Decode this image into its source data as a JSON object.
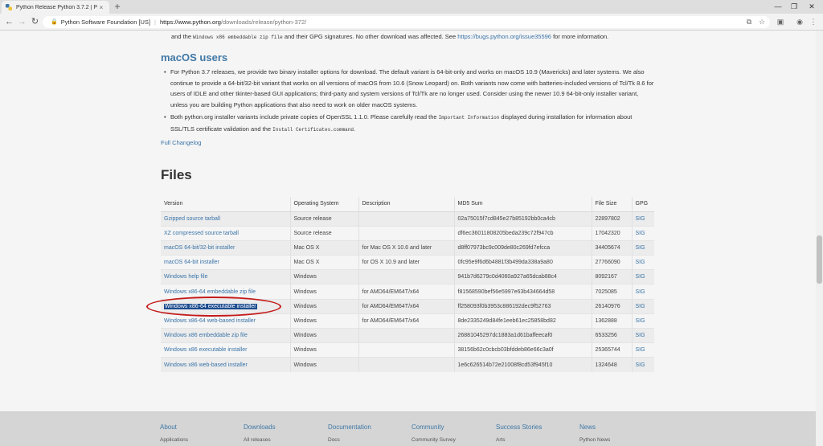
{
  "browser": {
    "tab_title": "Python Release Python 3.7.2 | Py",
    "tab_close": "×",
    "new_tab": "+",
    "url_site_label": "Python Software Foundation [US]",
    "url_host": "https://www.python.org",
    "url_path": "/downloads/release/python-372/",
    "win_min": "—",
    "win_max": "❐",
    "win_close": "✕"
  },
  "top_line": {
    "prefix": "and the ",
    "mono": "Windows x86 embeddable zip file",
    "middle": " and their GPG signatures. No other download was affected. See ",
    "link": "https://bugs.python.org/issue35596",
    "suffix": " for more information."
  },
  "macos": {
    "heading": "macOS users",
    "bullet1": "For Python 3.7 releases, we provide two binary installer options for download. The default variant is 64-bit-only and works on macOS 10.9 (Mavericks) and later systems. We also continue to provide a 64-bit/32-bit variant that works on all versions of macOS from 10.6 (Snow Leopard) on. Both variants now come with batteries-included versions of Tcl/Tk 8.6 for users of IDLE and other tkinter-based GUI applications; third-party and system versions of Tcl/Tk are no longer used. Consider using the newer 10.9 64-bit-only installer variant, unless you are building Python applications that also need to work on older macOS systems.",
    "bullet2_a": "Both python.org installer variants include private copies of OpenSSL 1.1.0. Please carefully read the ",
    "bullet2_mono1": "Important Information",
    "bullet2_b": " displayed during installation for information about SSL/TLS certificate validation and the ",
    "bullet2_mono2": "Install Certificates.command",
    "bullet2_c": "."
  },
  "changelog_link": "Full Changelog",
  "files": {
    "heading": "Files",
    "columns": [
      "Version",
      "Operating System",
      "Description",
      "MD5 Sum",
      "File Size",
      "GPG"
    ],
    "rows": [
      {
        "version": "Gzipped source tarball",
        "os": "Source release",
        "desc": "",
        "md5": "02a75015f7cd845e27b85192bb0ca4cb",
        "size": "22897802",
        "gpg": "SIG"
      },
      {
        "version": "XZ compressed source tarball",
        "os": "Source release",
        "desc": "",
        "md5": "df6ec36011808205beda239c72f947cb",
        "size": "17042320",
        "gpg": "SIG"
      },
      {
        "version": "macOS 64-bit/32-bit installer",
        "os": "Mac OS X",
        "desc": "for Mac OS X 10.6 and later",
        "md5": "d8ff07973bc9c009de80c269fd7efcca",
        "size": "34405674",
        "gpg": "SIG"
      },
      {
        "version": "macOS 64-bit installer",
        "os": "Mac OS X",
        "desc": "for OS X 10.9 and later",
        "md5": "0fc95e9f6d6b4881f3b499da338a9a80",
        "size": "27766090",
        "gpg": "SIG"
      },
      {
        "version": "Windows help file",
        "os": "Windows",
        "desc": "",
        "md5": "941b7d6279c0d4060a927a65dcab88c4",
        "size": "8092167",
        "gpg": "SIG"
      },
      {
        "version": "Windows x86-64 embeddable zip file",
        "os": "Windows",
        "desc": "for AMD64/EM64T/x64",
        "md5": "f81568590bef56e5997e63b434664d58",
        "size": "7025085",
        "gpg": "SIG"
      },
      {
        "version": "Windows x86-64 executable installer",
        "os": "Windows",
        "desc": "for AMD64/EM64T/x64",
        "md5": "ff258093f0b3953c886192dec9f52763",
        "size": "26140976",
        "gpg": "SIG"
      },
      {
        "version": "Windows x86-64 web-based installer",
        "os": "Windows",
        "desc": "for AMD64/EM64T/x64",
        "md5": "8de2335249d84fe1eeb61ec25858bd82",
        "size": "1362888",
        "gpg": "SIG"
      },
      {
        "version": "Windows x86 embeddable zip file",
        "os": "Windows",
        "desc": "",
        "md5": "26881045297dc1883a1d61baffeecaf0",
        "size": "6533256",
        "gpg": "SIG"
      },
      {
        "version": "Windows x86 executable installer",
        "os": "Windows",
        "desc": "",
        "md5": "38156b62c0cbcb03bfddeb86e66c3a0f",
        "size": "25365744",
        "gpg": "SIG"
      },
      {
        "version": "Windows x86 web-based installer",
        "os": "Windows",
        "desc": "",
        "md5": "1e6c626514b72e21008f8cd53f945f10",
        "size": "1324648",
        "gpg": "SIG"
      }
    ]
  },
  "footer": [
    {
      "title": "About",
      "sub": "Applications"
    },
    {
      "title": "Downloads",
      "sub": "All releases"
    },
    {
      "title": "Documentation",
      "sub": "Docs"
    },
    {
      "title": "Community",
      "sub": "Community Survey"
    },
    {
      "title": "Success Stories",
      "sub": "Arts"
    },
    {
      "title": "News",
      "sub": "Python News"
    }
  ],
  "colors": {
    "link": "#3a74a8",
    "selection": "#1d4c8f",
    "annotation": "#c41a1a"
  }
}
